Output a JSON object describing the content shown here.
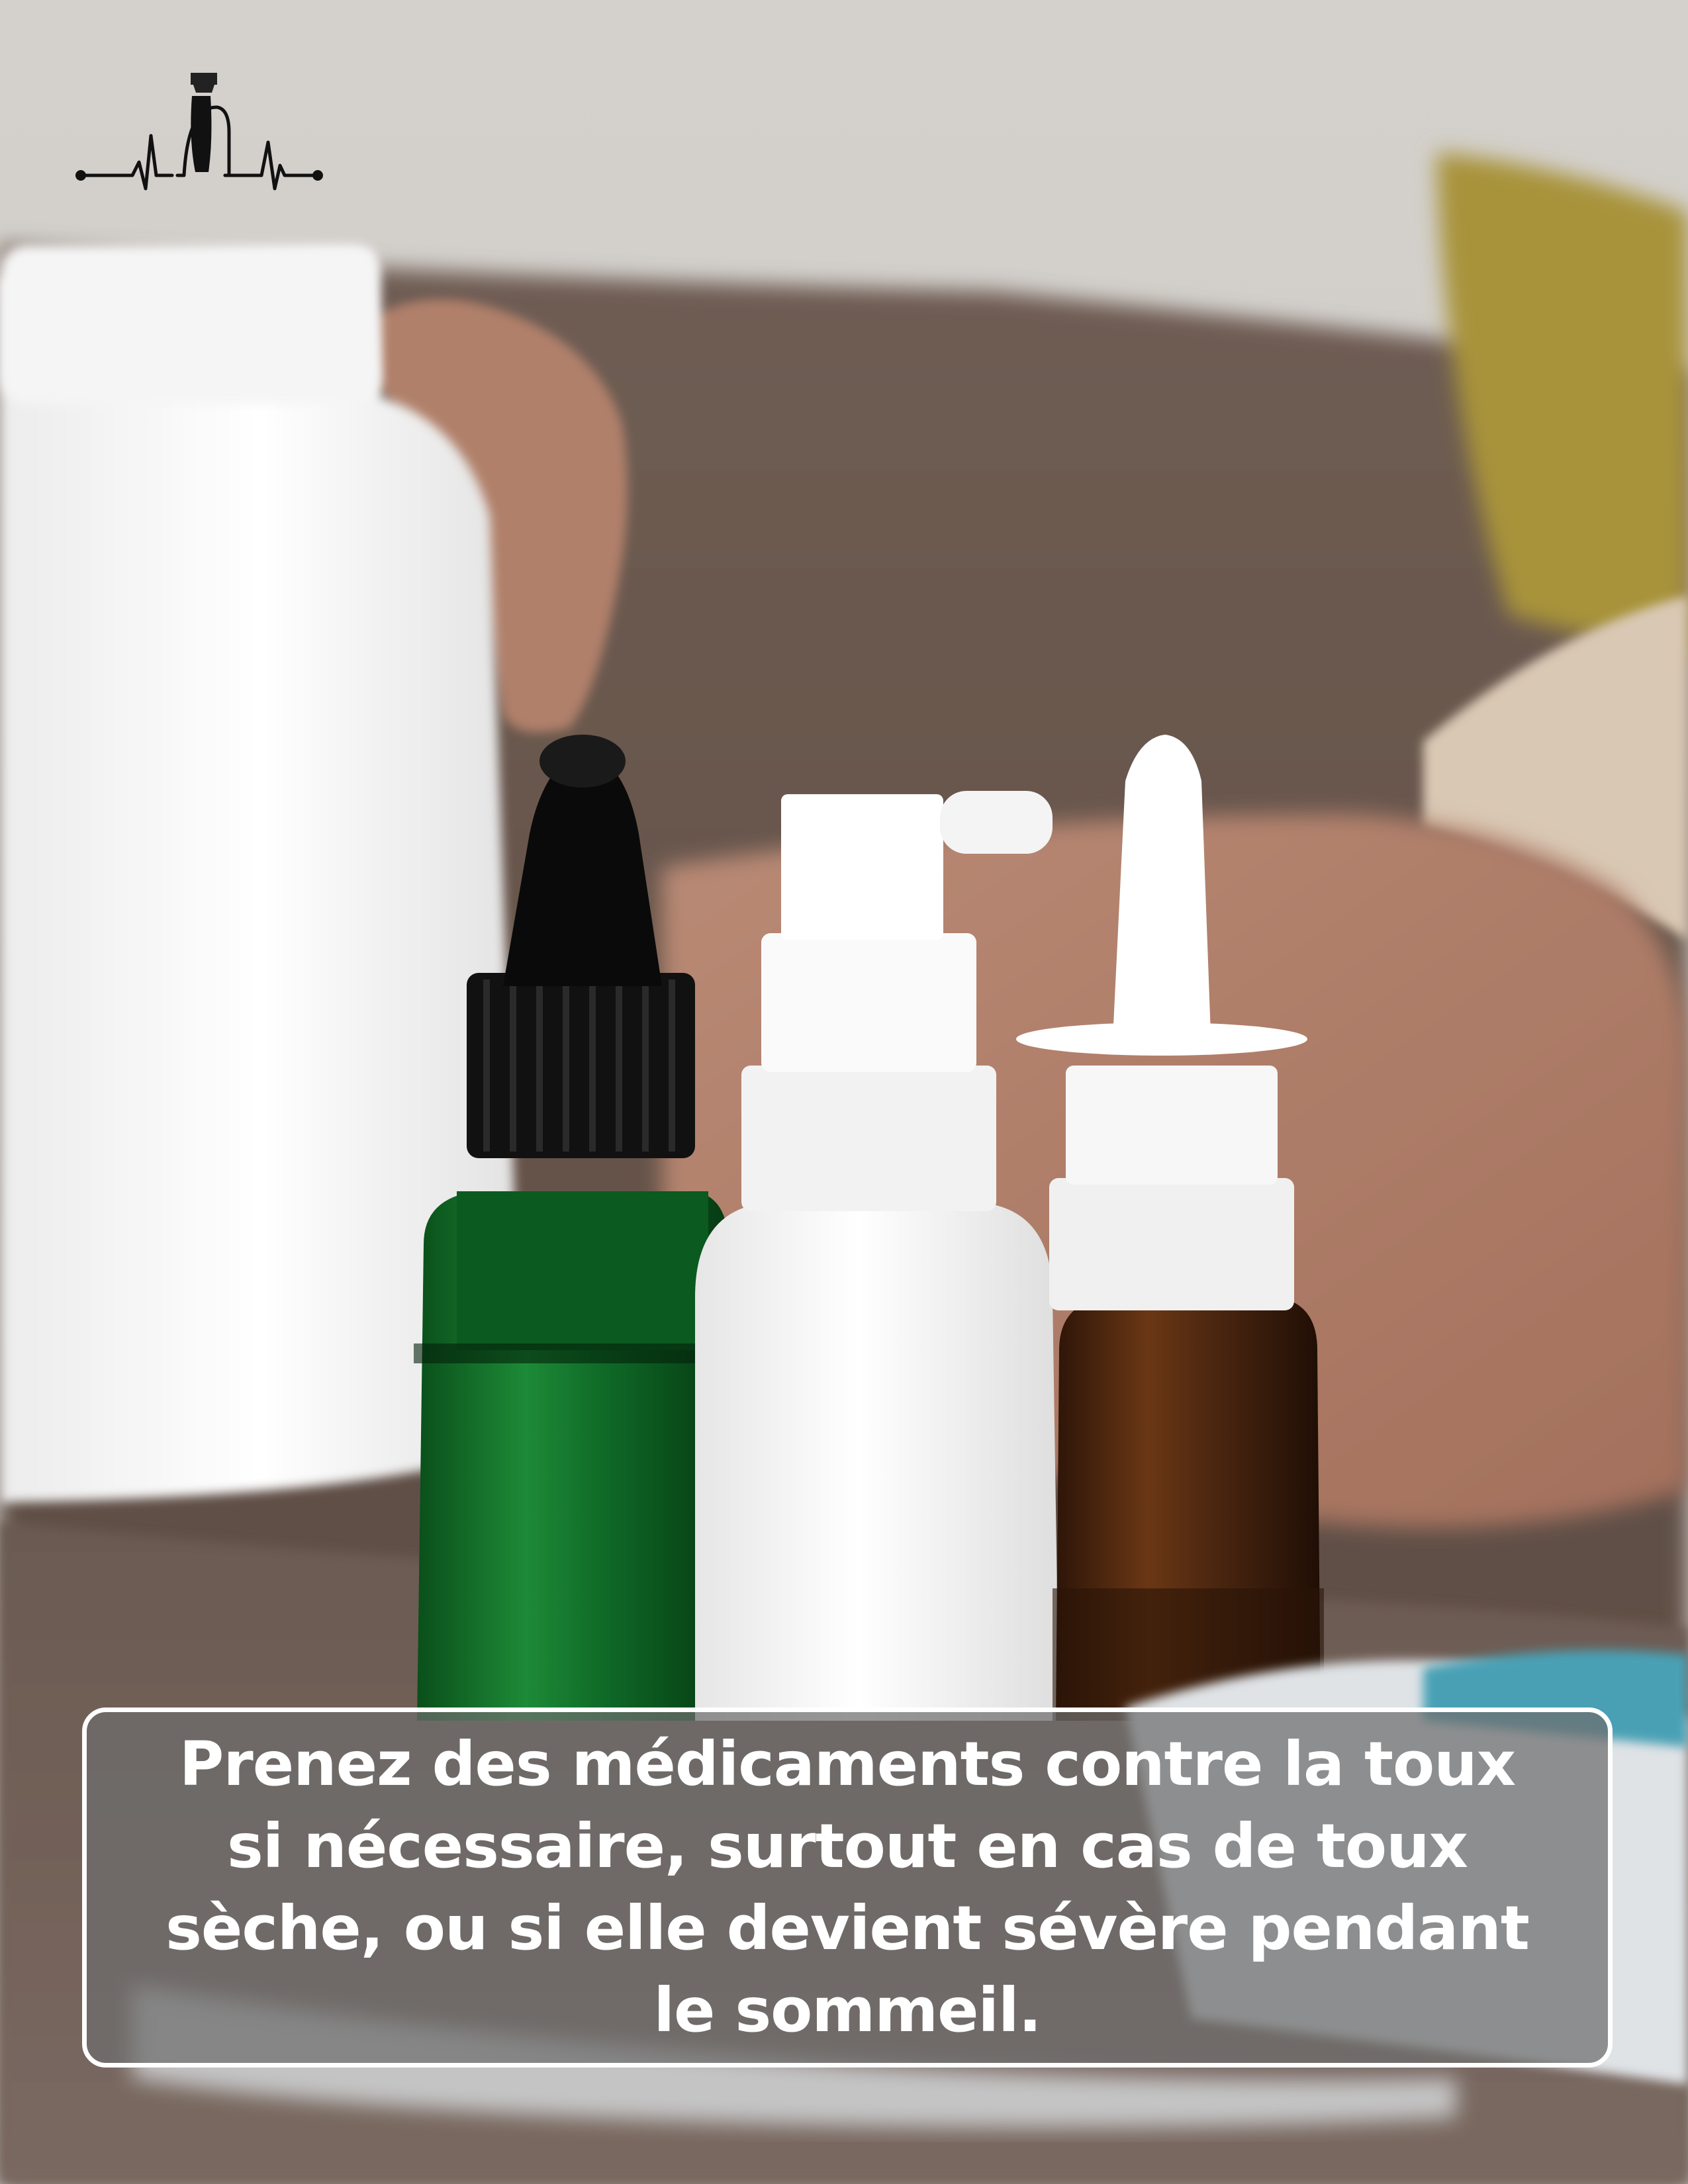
{
  "logo": {
    "icon": "heartbeat-figure-logo-icon"
  },
  "photo": {
    "subject": "medicine-bottles-photo",
    "colors": {
      "background_wall": "#d7d4d0",
      "sofa": "#6e5a4f",
      "pillow": "#b09a3a",
      "skin": "#c99a83",
      "green_bottle": "#0d6b25",
      "amber_bottle": "#4a2610",
      "white_plastic": "#f7f7f7"
    }
  },
  "caption": {
    "text": "Prenez des médicaments contre la toux si nécessaire, surtout en cas de toux sèche, ou si elle devient sévère pendant le sommeil.",
    "text_color": "#ffffff",
    "box_color": "#6e6e6e",
    "border_color": "#ffffff"
  }
}
